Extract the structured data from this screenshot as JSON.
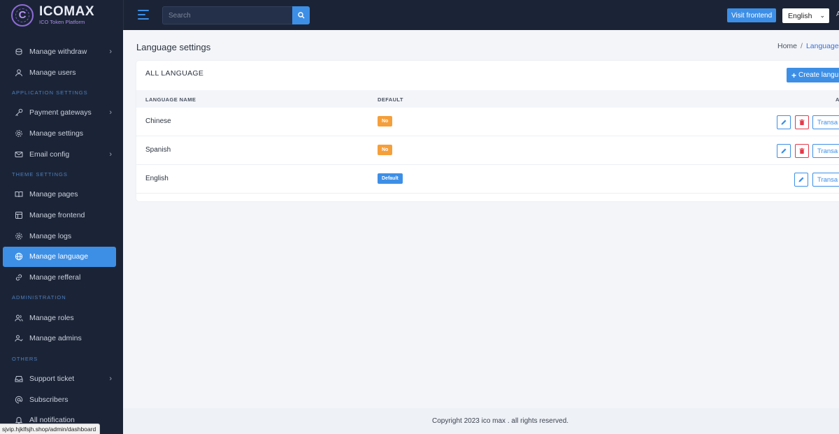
{
  "brand": {
    "name": "ICOMAX",
    "subtitle": "ICO Token Platform"
  },
  "sidebar": {
    "items_top": [
      {
        "label": "Manage withdraw",
        "icon": "coins-icon",
        "chevron": true
      },
      {
        "label": "Manage users",
        "icon": "user-icon",
        "chevron": false
      }
    ],
    "sections": [
      {
        "heading": "APPLICATION SETTINGS",
        "items": [
          {
            "label": "Payment gateways",
            "icon": "key-icon",
            "chevron": true
          },
          {
            "label": "Manage settings",
            "icon": "gear-icon",
            "chevron": false
          },
          {
            "label": "Email config",
            "icon": "mail-icon",
            "chevron": true
          }
        ]
      },
      {
        "heading": "THEME SETTINGS",
        "items": [
          {
            "label": "Manage pages",
            "icon": "book-icon",
            "chevron": false
          },
          {
            "label": "Manage frontend",
            "icon": "layout-icon",
            "chevron": false
          },
          {
            "label": "Manage logs",
            "icon": "gear-icon",
            "chevron": false
          },
          {
            "label": "Manage language",
            "icon": "globe-icon",
            "chevron": false,
            "active": true
          },
          {
            "label": "Manage refferal",
            "icon": "link-icon",
            "chevron": false
          }
        ]
      },
      {
        "heading": "ADMINISTRATION",
        "items": [
          {
            "label": "Manage roles",
            "icon": "users-icon",
            "chevron": false
          },
          {
            "label": "Manage admins",
            "icon": "user-check-icon",
            "chevron": false
          }
        ]
      },
      {
        "heading": "OTHERS",
        "items": [
          {
            "label": "Support ticket",
            "icon": "inbox-icon",
            "chevron": true
          },
          {
            "label": "Subscribers",
            "icon": "at-icon",
            "chevron": false
          },
          {
            "label": "All notification",
            "icon": "bell-icon",
            "chevron": false
          }
        ]
      }
    ]
  },
  "status_url": "sjvip.hjklfsjh.shop/admin/dashboard",
  "topbar": {
    "search_placeholder": "Search",
    "visit_label": "Visit frontend",
    "language": "English",
    "extra": "A"
  },
  "page": {
    "title": "Language settings",
    "breadcrumb": {
      "home": "Home",
      "sep": "/",
      "current": "Language"
    }
  },
  "card": {
    "title": "ALL LANGUAGE",
    "create_label": "Create langu",
    "columns": [
      "LANGUAGE NAME",
      "DEFAULT",
      "A"
    ],
    "rows": [
      {
        "name": "Chinese",
        "default": "No",
        "deletable": true,
        "translate": "Transa"
      },
      {
        "name": "Spanish",
        "default": "No",
        "deletable": true,
        "translate": "Transa"
      },
      {
        "name": "English",
        "default": "Default",
        "deletable": false,
        "translate": "Transa"
      }
    ]
  },
  "footer": {
    "text": "Copyright 2023 ico max . all rights reserved."
  },
  "colors": {
    "sidebar_bg": "#1b2436",
    "accent": "#3d8fe6",
    "warning": "#f59f3a",
    "danger": "#e5394a"
  }
}
